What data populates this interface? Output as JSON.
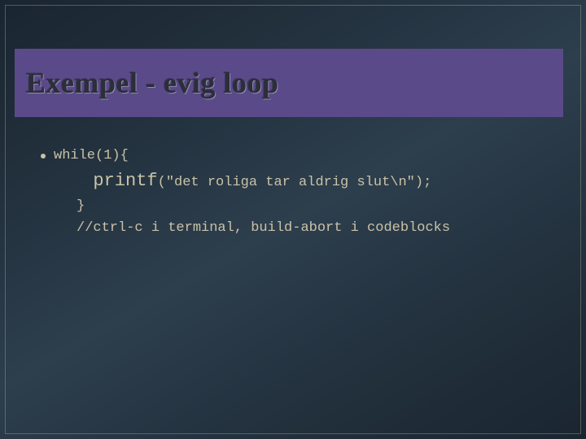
{
  "slide": {
    "title": "Exempel -  evig loop",
    "bullet_line": "while(1){",
    "code_line1_kw": "printf",
    "code_line1_args": "(\"det roliga tar aldrig slut\\n\");",
    "code_line2": "}",
    "code_line3": "//ctrl-c i terminal, build-abort i codeblocks"
  }
}
